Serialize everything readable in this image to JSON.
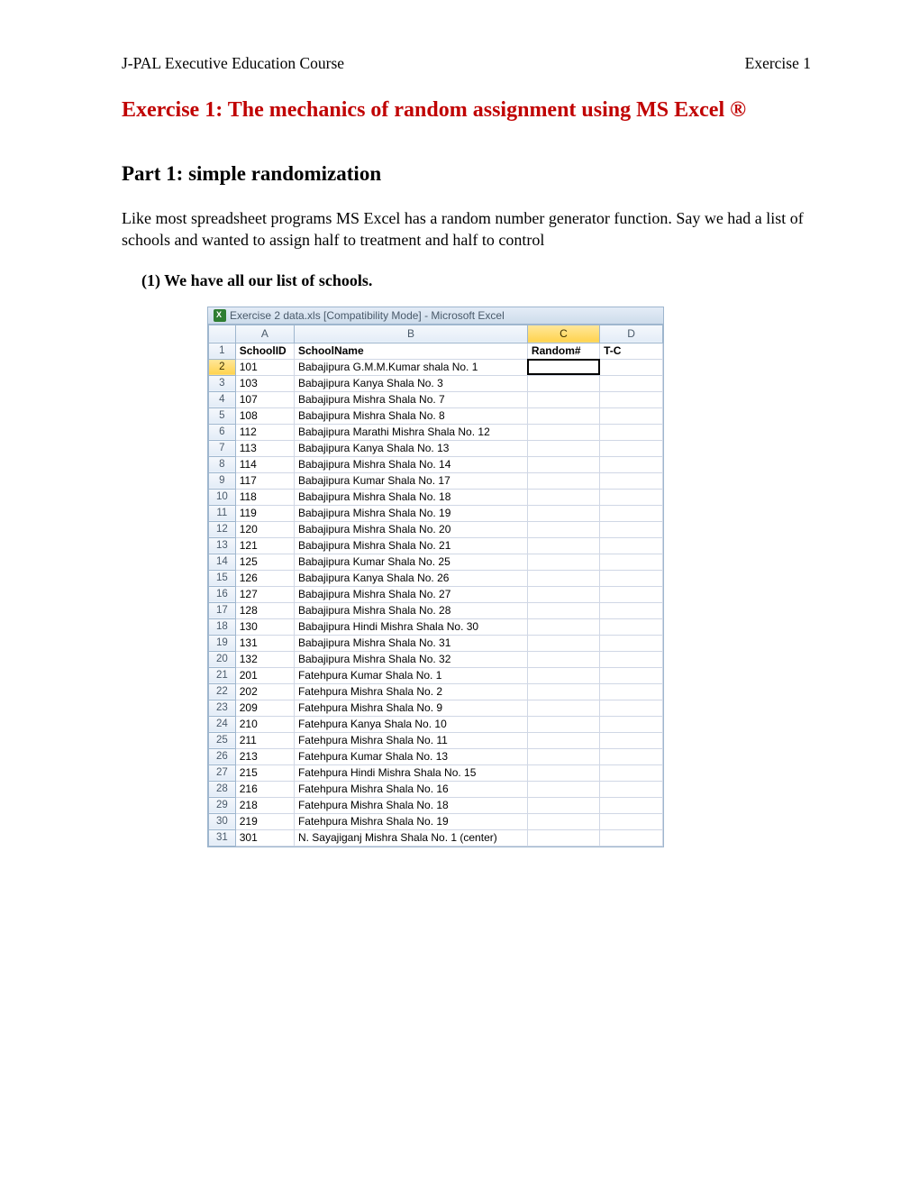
{
  "header": {
    "left": "J-PAL Executive Education Course",
    "right": "Exercise 1"
  },
  "title": "Exercise 1: The mechanics of random assignment using MS Excel ®",
  "part_title": "Part 1: simple randomization",
  "body_text": "Like most spreadsheet programs MS Excel has a random number generator function. Say we had a list of schools and wanted to assign half to treatment and half to control",
  "list_item": "(1) We have all our list of schools.",
  "excel": {
    "titlebar": "Exercise 2 data.xls  [Compatibility Mode] - Microsoft Excel",
    "columns": [
      "A",
      "B",
      "C",
      "D"
    ],
    "selected_col_index": 2,
    "header_row": {
      "row_num": "1",
      "A": "SchoolID",
      "B": "SchoolName",
      "C": "Random#",
      "D": "T-C"
    },
    "active_cell": {
      "row": 2,
      "col": "C"
    },
    "rows": [
      {
        "n": "2",
        "A": "101",
        "B": "Babajipura G.M.M.Kumar shala No. 1",
        "C": "",
        "D": ""
      },
      {
        "n": "3",
        "A": "103",
        "B": "Babajipura Kanya Shala No. 3",
        "C": "",
        "D": ""
      },
      {
        "n": "4",
        "A": "107",
        "B": "Babajipura Mishra Shala No. 7",
        "C": "",
        "D": ""
      },
      {
        "n": "5",
        "A": "108",
        "B": "Babajipura Mishra Shala No. 8",
        "C": "",
        "D": ""
      },
      {
        "n": "6",
        "A": "112",
        "B": "Babajipura Marathi Mishra Shala No. 12",
        "C": "",
        "D": ""
      },
      {
        "n": "7",
        "A": "113",
        "B": "Babajipura Kanya Shala No. 13",
        "C": "",
        "D": ""
      },
      {
        "n": "8",
        "A": "114",
        "B": "Babajipura Mishra Shala No. 14",
        "C": "",
        "D": ""
      },
      {
        "n": "9",
        "A": "117",
        "B": "Babajipura Kumar Shala No. 17",
        "C": "",
        "D": ""
      },
      {
        "n": "10",
        "A": "118",
        "B": "Babajipura Mishra Shala No. 18",
        "C": "",
        "D": ""
      },
      {
        "n": "11",
        "A": "119",
        "B": "Babajipura Mishra Shala No. 19",
        "C": "",
        "D": ""
      },
      {
        "n": "12",
        "A": "120",
        "B": "Babajipura Mishra Shala No. 20",
        "C": "",
        "D": ""
      },
      {
        "n": "13",
        "A": "121",
        "B": "Babajipura Mishra Shala No. 21",
        "C": "",
        "D": ""
      },
      {
        "n": "14",
        "A": "125",
        "B": "Babajipura Kumar Shala No. 25",
        "C": "",
        "D": ""
      },
      {
        "n": "15",
        "A": "126",
        "B": "Babajipura Kanya Shala No. 26",
        "C": "",
        "D": ""
      },
      {
        "n": "16",
        "A": "127",
        "B": "Babajipura Mishra Shala No. 27",
        "C": "",
        "D": ""
      },
      {
        "n": "17",
        "A": "128",
        "B": "Babajipura Mishra Shala No. 28",
        "C": "",
        "D": ""
      },
      {
        "n": "18",
        "A": "130",
        "B": "Babajipura Hindi Mishra Shala No. 30",
        "C": "",
        "D": ""
      },
      {
        "n": "19",
        "A": "131",
        "B": "Babajipura Mishra Shala No. 31",
        "C": "",
        "D": ""
      },
      {
        "n": "20",
        "A": "132",
        "B": "Babajipura Mishra Shala No. 32",
        "C": "",
        "D": ""
      },
      {
        "n": "21",
        "A": "201",
        "B": "Fatehpura Kumar Shala No. 1",
        "C": "",
        "D": ""
      },
      {
        "n": "22",
        "A": "202",
        "B": "Fatehpura Mishra Shala No. 2",
        "C": "",
        "D": ""
      },
      {
        "n": "23",
        "A": "209",
        "B": "Fatehpura Mishra Shala No. 9",
        "C": "",
        "D": ""
      },
      {
        "n": "24",
        "A": "210",
        "B": "Fatehpura Kanya Shala No. 10",
        "C": "",
        "D": ""
      },
      {
        "n": "25",
        "A": "211",
        "B": "Fatehpura Mishra Shala No. 11",
        "C": "",
        "D": ""
      },
      {
        "n": "26",
        "A": "213",
        "B": "Fatehpura Kumar Shala No. 13",
        "C": "",
        "D": ""
      },
      {
        "n": "27",
        "A": "215",
        "B": "Fatehpura Hindi Mishra Shala No. 15",
        "C": "",
        "D": ""
      },
      {
        "n": "28",
        "A": "216",
        "B": "Fatehpura Mishra Shala No. 16",
        "C": "",
        "D": ""
      },
      {
        "n": "29",
        "A": "218",
        "B": "Fatehpura Mishra Shala No. 18",
        "C": "",
        "D": ""
      },
      {
        "n": "30",
        "A": "219",
        "B": "Fatehpura Mishra Shala No. 19",
        "C": "",
        "D": ""
      },
      {
        "n": "31",
        "A": "301",
        "B": "N. Sayajiganj Mishra Shala No. 1 (center)",
        "C": "",
        "D": ""
      }
    ]
  }
}
